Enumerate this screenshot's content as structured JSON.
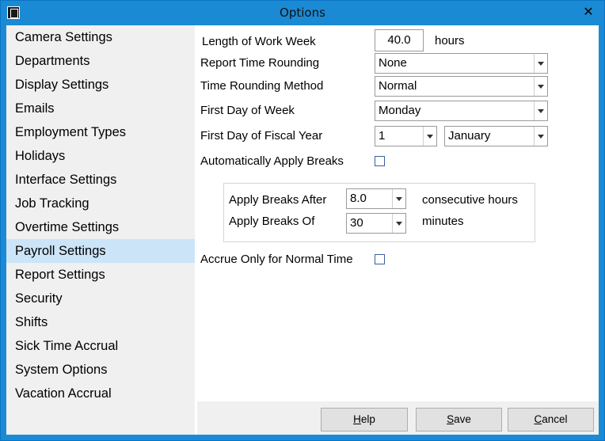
{
  "window": {
    "title": "Options"
  },
  "sidebar": {
    "items": [
      {
        "label": "Camera Settings"
      },
      {
        "label": "Departments"
      },
      {
        "label": "Display Settings"
      },
      {
        "label": "Emails"
      },
      {
        "label": "Employment Types"
      },
      {
        "label": "Holidays"
      },
      {
        "label": "Interface Settings"
      },
      {
        "label": "Job Tracking"
      },
      {
        "label": "Overtime Settings"
      },
      {
        "label": "Payroll Settings"
      },
      {
        "label": "Report Settings"
      },
      {
        "label": "Security"
      },
      {
        "label": "Shifts"
      },
      {
        "label": "Sick Time Accrual"
      },
      {
        "label": "System Options"
      },
      {
        "label": "Vacation Accrual"
      }
    ],
    "selected": "Payroll Settings"
  },
  "payroll": {
    "work_week_label": "Length of Work Week",
    "work_week_value": "40.0",
    "work_week_unit": "hours",
    "rounding_label": "Report Time Rounding",
    "rounding_value": "None",
    "method_label": "Time Rounding Method",
    "method_value": "Normal",
    "first_day_label": "First Day of Week",
    "first_day_value": "Monday",
    "fiscal_label": "First Day of Fiscal Year",
    "fiscal_day_value": "1",
    "fiscal_month_value": "January",
    "auto_breaks_label": "Automatically Apply Breaks",
    "auto_breaks_checked": false,
    "breaks_after_label": "Apply Breaks After",
    "breaks_after_value": "8.0",
    "breaks_after_unit": "consecutive hours",
    "breaks_of_label": "Apply Breaks Of",
    "breaks_of_value": "30",
    "breaks_of_unit": "minutes",
    "accrue_label": "Accrue Only for Normal Time",
    "accrue_checked": false
  },
  "buttons": {
    "help_first": "H",
    "help_rest": "elp",
    "save_first": "S",
    "save_rest": "ave",
    "cancel_first": "C",
    "cancel_rest": "ancel"
  },
  "colors": {
    "titlebar": "#1a8ad4",
    "selected": "#cce4f7",
    "sidebar_bg": "#f0f0f0"
  }
}
